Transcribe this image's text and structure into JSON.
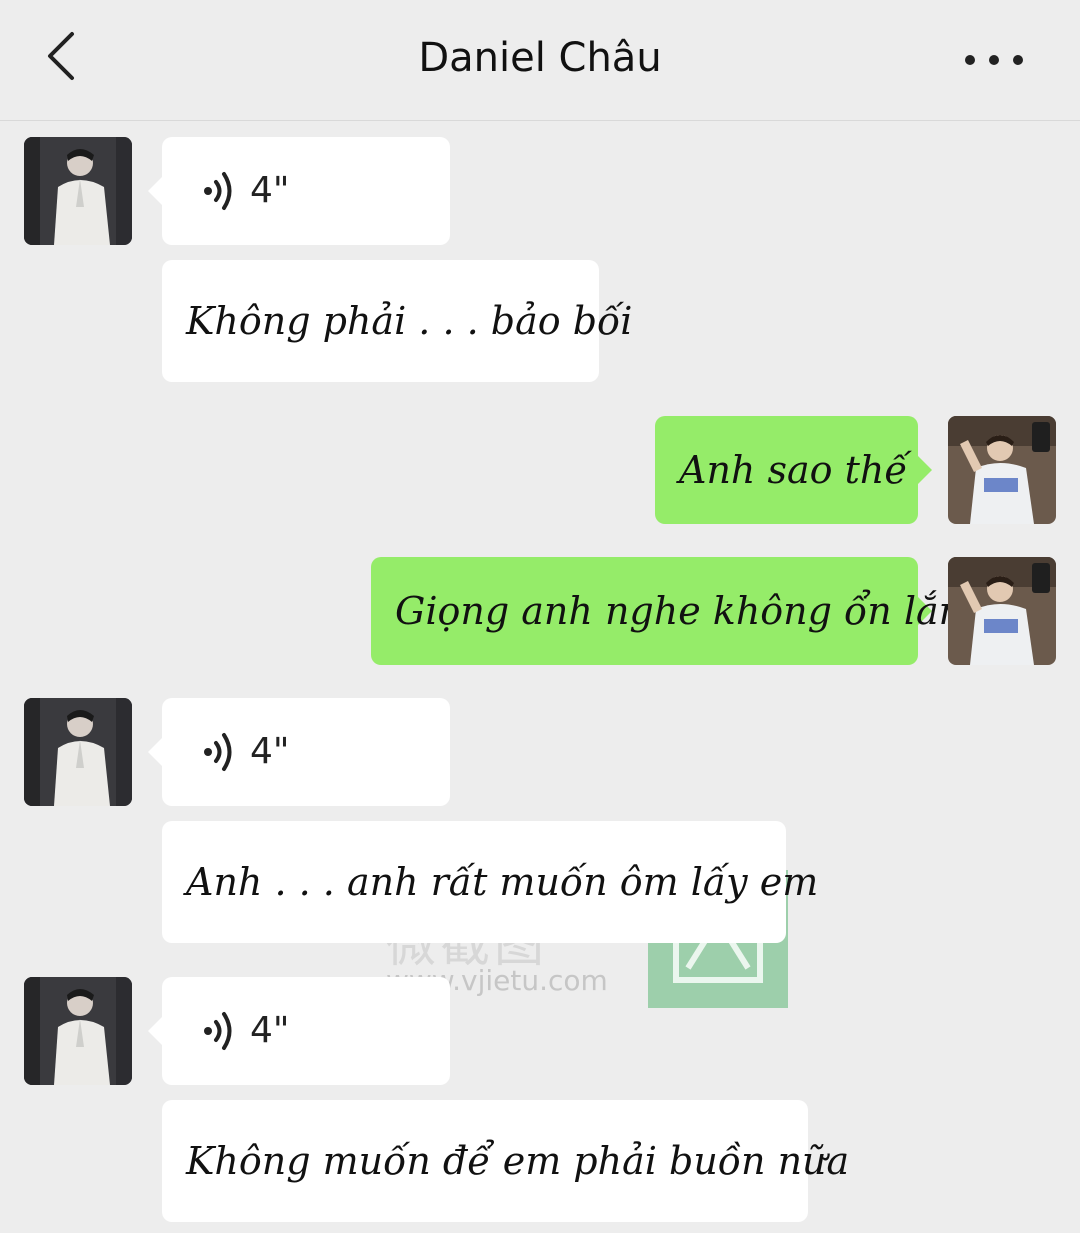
{
  "header": {
    "title": "Daniel Châu",
    "back_icon": "chevron-left-icon",
    "more_icon": "more-dots-icon"
  },
  "colors": {
    "background": "#ededed",
    "incoming_bubble": "#ffffff",
    "outgoing_bubble": "#95ec69"
  },
  "messages": [
    {
      "sender": "contact",
      "type": "voice",
      "duration": "4\""
    },
    {
      "sender": "contact",
      "type": "text",
      "text": "Không phải . . . bảo bối"
    },
    {
      "sender": "me",
      "type": "text",
      "text": "Anh sao thế"
    },
    {
      "sender": "me",
      "type": "text",
      "text": "Giọng anh nghe không ổn lắm"
    },
    {
      "sender": "contact",
      "type": "voice",
      "duration": "4\""
    },
    {
      "sender": "contact",
      "type": "text",
      "text": "Anh . . . anh rất muốn ôm lấy em"
    },
    {
      "sender": "contact",
      "type": "voice",
      "duration": "4\""
    },
    {
      "sender": "contact",
      "type": "text",
      "text": "Không muốn để em phải buồn nữa"
    }
  ],
  "watermark": {
    "text": "微截图",
    "url": "www.vjietu.com"
  }
}
